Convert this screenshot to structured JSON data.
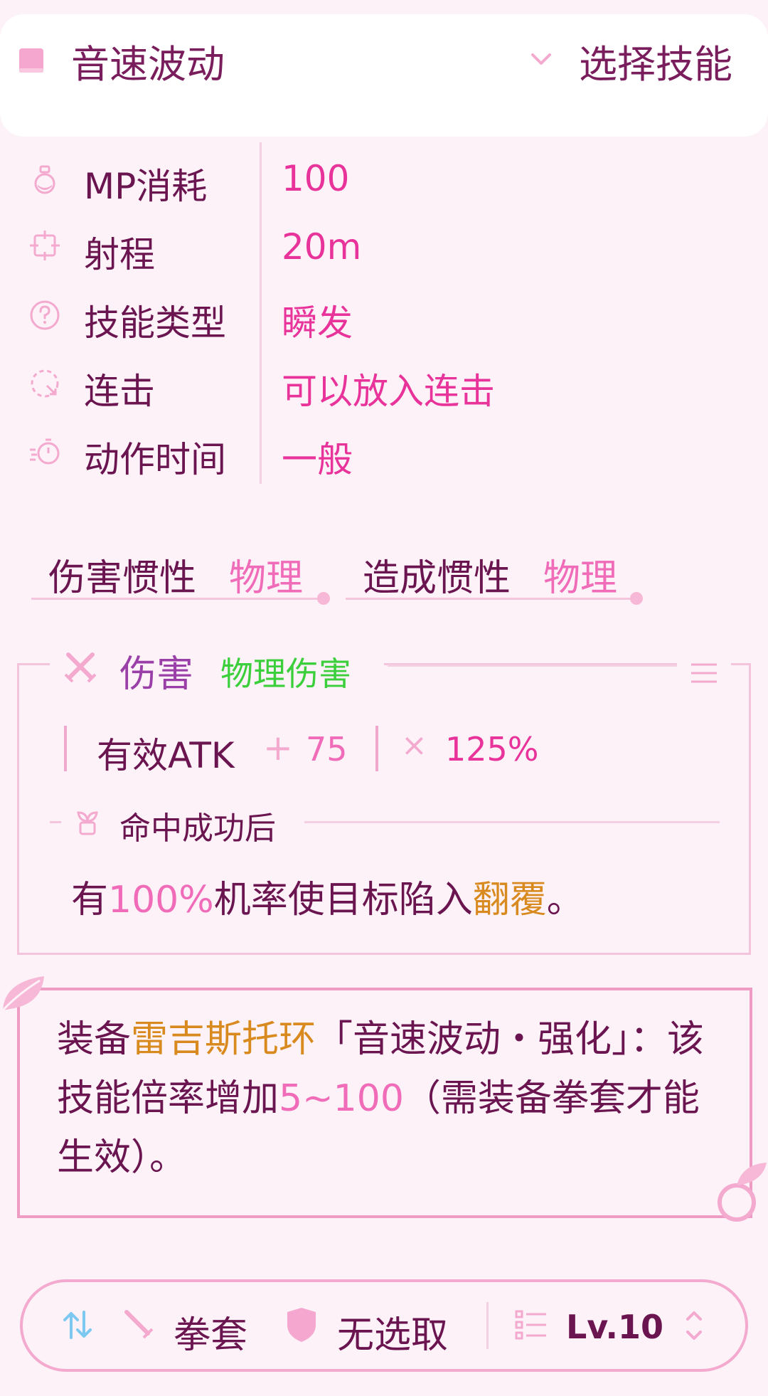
{
  "header": {
    "skill_name": "音速波动",
    "select_label": "选择技能"
  },
  "info": {
    "rows": [
      {
        "label": "MP消耗",
        "value": "100",
        "icon": "potion-icon"
      },
      {
        "label": "射程",
        "value": "20m",
        "icon": "crosshair-icon"
      },
      {
        "label": "技能类型",
        "value": "瞬发",
        "icon": "question-icon"
      },
      {
        "label": "连击",
        "value": "可以放入连击",
        "icon": "combo-icon"
      },
      {
        "label": "动作时间",
        "value": "一般",
        "icon": "timer-icon"
      }
    ]
  },
  "inertia": {
    "damage_label": "伤害惯性",
    "damage_value": "物理",
    "cause_label": "造成惯性",
    "cause_value": "物理"
  },
  "damage": {
    "title": "伤害",
    "type": "物理伤害",
    "formula_label": "有效ATK",
    "formula_op": "+",
    "formula_value": "75",
    "formula_times": "×",
    "formula_multiplier": "125%",
    "on_hit_label": "命中成功后",
    "effect_pre": "有",
    "effect_chance": "100%",
    "effect_mid": "机率使目标陷入",
    "effect_status": "翻覆",
    "effect_post": "。"
  },
  "note": {
    "pre": "装备",
    "item": "雷吉斯托环",
    "mid": "「音速波动・强化」：该技能倍率增加",
    "value": "5~100",
    "post": "（需装备拳套才能生效）。"
  },
  "bottom_bar": {
    "weapon": "拳套",
    "selection": "无选取",
    "level": "Lv.10"
  },
  "colors": {
    "background": "#fdf2f8",
    "accent_pink": "#e8339a",
    "text_purple": "#6b1550",
    "damage_green": "#3ccf3c",
    "highlight_orange": "#d98a1e"
  }
}
